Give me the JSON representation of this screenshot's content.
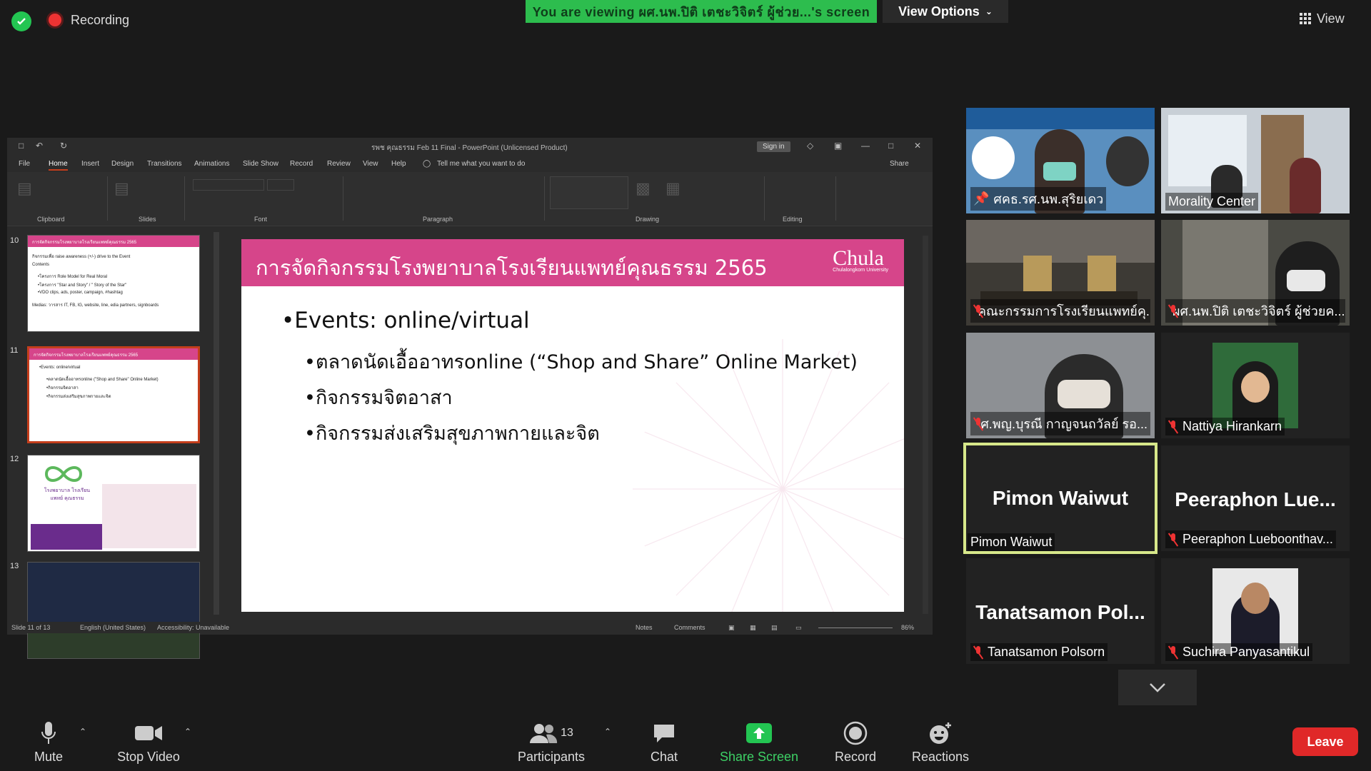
{
  "top": {
    "recording": "Recording",
    "viewing_banner": "You are viewing ผศ.นพ.ปิติ เตชะวิจิตร์ ผู้ช่วย...'s screen",
    "view_options": "View Options",
    "view": "View"
  },
  "ppt": {
    "title": "รพช คุณธรรม Feb 11 Final  -  PowerPoint (Unlicensed Product)",
    "sign_in": "Sign in",
    "menu": [
      "File",
      "Home",
      "Insert",
      "Design",
      "Transitions",
      "Animations",
      "Slide Show",
      "Record",
      "Review",
      "View",
      "Help"
    ],
    "tell_me": "Tell me what you want to do",
    "share": "Share",
    "ribbon_groups": [
      "Clipboard",
      "Slides",
      "Font",
      "Paragraph",
      "Drawing",
      "Editing"
    ],
    "status": {
      "slide": "Slide 11 of 13",
      "language": "English (United States)",
      "accessibility": "Accessibility: Unavailable",
      "notes": "Notes",
      "comments": "Comments",
      "zoom": "86%"
    }
  },
  "thumbs": [
    {
      "num": "10",
      "head": "การจัดกิจกรรมโรงพยาบาลโรงเรียนแพทย์คุณธรรม 2565",
      "lines": [
        "กิจกรรมเพื่อ raise awareness (+/-) drive to the Event",
        "Contents",
        "•โครงการ Role Model for Real Moral",
        "•โครงการ \"Star and Story\" / \" Story of the Star\"",
        "•VDO clips, ads, poster, campaign, #hashtag",
        "Medias: วารสาร IT, FB, IG, website, line, edia partners, signboards"
      ]
    },
    {
      "num": "11",
      "head": "การจัดกิจกรรมโรงพยาบาลโรงเรียนแพทย์คุณธรรม 2565",
      "lines": [
        "•Events: online/virtual",
        "•ตลาดนัดเอื้ออาทรonline (\"Shop and Share\" Online Market)",
        "•กิจกรรมจิตอาสา",
        "•กิจกรรมส่งเสริมสุขภาพกายและจิต"
      ]
    },
    {
      "num": "12",
      "text": "โรงพยาบาล โรงเรียนแพทย์ คุณธรรม"
    },
    {
      "num": "13"
    }
  ],
  "slide": {
    "title": "การจัดกิจกรรมโรงพยาบาลโรงเรียนแพทย์คุณธรรม 2565",
    "logo": "Chula",
    "logo_sub": "Chulalongkorn University",
    "bullet1": "Events: online/virtual",
    "sub1": "ตลาดนัดเอื้ออาทรonline (“Shop and Share” Online Market)",
    "sub2": "กิจกรรมจิตอาสา",
    "sub3": "กิจกรรมส่งเสริมสุขภาพกายและจิต"
  },
  "participants_tiles": [
    {
      "label": "ศคธ.รศ.นพ.สุริยเดว"
    },
    {
      "label": "Morality Center"
    },
    {
      "label": "คณะกรรมการโรงเรียนแพทย์คุ..."
    },
    {
      "label": "ผศ.นพ.ปิติ เตชะวิจิตร์ ผู้ช่วยค..."
    },
    {
      "label": "ศ.พญ.บุรณี กาญจนถวัลย์ รอ..."
    },
    {
      "label": "Nattiya Hirankarn"
    },
    {
      "label": "Pimon Waiwut",
      "big": "Pimon Waiwut"
    },
    {
      "label": "Peeraphon Lueboonthav...",
      "big": "Peeraphon  Lue..."
    },
    {
      "label": "Tanatsamon Polsorn",
      "big": "Tanatsamon  Pol..."
    },
    {
      "label": "Suchira Panyasantikul"
    }
  ],
  "toolbar": {
    "mute": "Mute",
    "stop_video": "Stop Video",
    "participants": "Participants",
    "participants_count": "13",
    "chat": "Chat",
    "share_screen": "Share Screen",
    "record": "Record",
    "reactions": "Reactions",
    "leave": "Leave"
  },
  "colors": {
    "accent_green": "#2dbd4e",
    "slide_pink": "#d6458a",
    "leave_red": "#e02828",
    "active_speaker": "#d7e88a"
  }
}
